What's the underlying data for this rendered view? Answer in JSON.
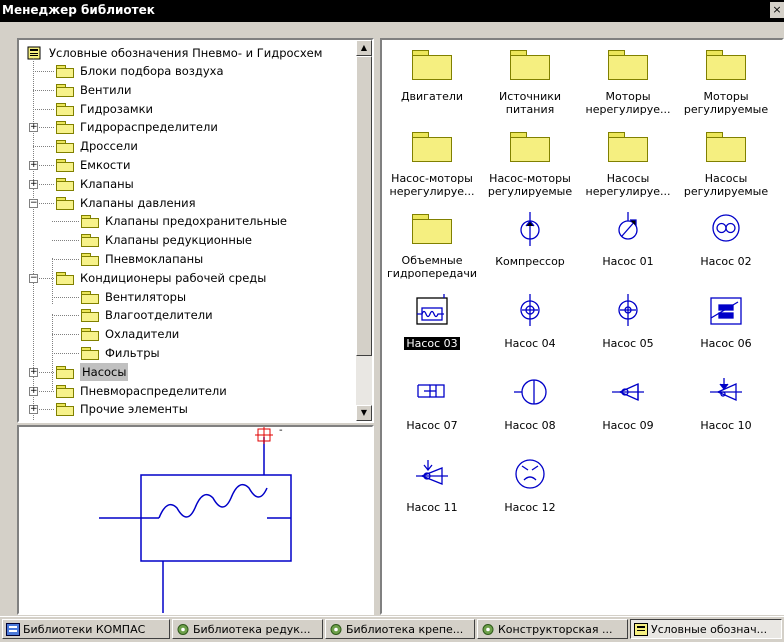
{
  "window": {
    "title": "Менеджер библиотек",
    "close": "×"
  },
  "tree": {
    "root": "Условные обозначения Пневмо- и Гидросхем",
    "items": [
      "Блоки подбора воздуха",
      "Вентили",
      "Гидрозамки",
      "Гидрораспределители",
      "Дроссели",
      "Емкости",
      "Клапаны",
      "Клапаны давления",
      "Клапаны предохранительные",
      "Клапаны редукционные",
      "Пневмоклапаны",
      "Кондиционеры рабочей среды",
      "Вентиляторы",
      "Влагоотделители",
      "Охладители",
      "Фильтры",
      "Насосы",
      "Пневмораспределители",
      "Прочие элементы"
    ],
    "expanders": {
      "plus": "+",
      "minus": "−"
    }
  },
  "grid": {
    "items": [
      "Двигатели",
      "Источники питания",
      "Моторы нерегулируе...",
      "Моторы регулируемые",
      "Насос-моторы нерегулируе...",
      "Насос-моторы регулируемые",
      "Насосы нерегулируе...",
      "Насосы регулируемые",
      "Объемные гидропередачи",
      "Компрессор",
      "Насос 01",
      "Насос 02",
      "Насос 03",
      "Насос 04",
      "Насос 05",
      "Насос 06",
      "Насос 07",
      "Насос 08",
      "Насос 09",
      "Насос 10",
      "Насос 11",
      "Насос 12"
    ],
    "selected": "Насос 03"
  },
  "taskbar": {
    "tabs": [
      "Библиотеки КОМПАС",
      "Библиотека редук...",
      "Библиотека крепе...",
      "Конструкторская ...",
      "Условные обознач..."
    ],
    "active": "Условные обознач..."
  },
  "colors": {
    "symbol": "#0000c8",
    "folder": "#f5ef80",
    "selection": "#000000"
  }
}
